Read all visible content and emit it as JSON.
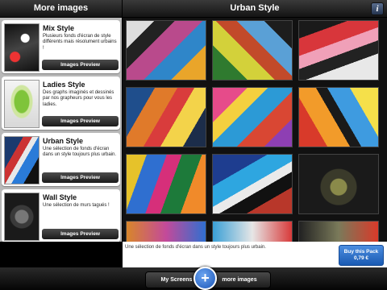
{
  "left_header": {
    "title": "More images"
  },
  "right_header": {
    "title": "Urban Style",
    "info_icon": "i"
  },
  "packs": [
    {
      "title": "Mix Style",
      "description": "Plusieurs fonds d'écran de style différents mais résolument urbains !",
      "button": "Images Preview"
    },
    {
      "title": "Ladies Style",
      "description": "Des graphs imaginés et dessinés par nos grapheurs pour vous les ladies.",
      "button": "Images Preview"
    },
    {
      "title": "Urban Style",
      "description": "Une sélection de fonds d'écran dans un style toujours plus urbain.",
      "button": "Images Preview"
    },
    {
      "title": "Wall Style",
      "description": "Une sélection de murs tagués !",
      "button": "Images Preview"
    }
  ],
  "info_bar": {
    "description": "Une sélection de fonds d'écran dans un style toujours plus urbain.",
    "buy_label": "Buy this Pack",
    "buy_price": "0,79 €"
  },
  "bottom_bar": {
    "left_tab": "My Screens",
    "right_tab": "more images"
  },
  "colors": {
    "accent_blue": "#2a6fd0",
    "panel_gray": "#b9b9b9",
    "header_dark": "#1e1e1e"
  }
}
